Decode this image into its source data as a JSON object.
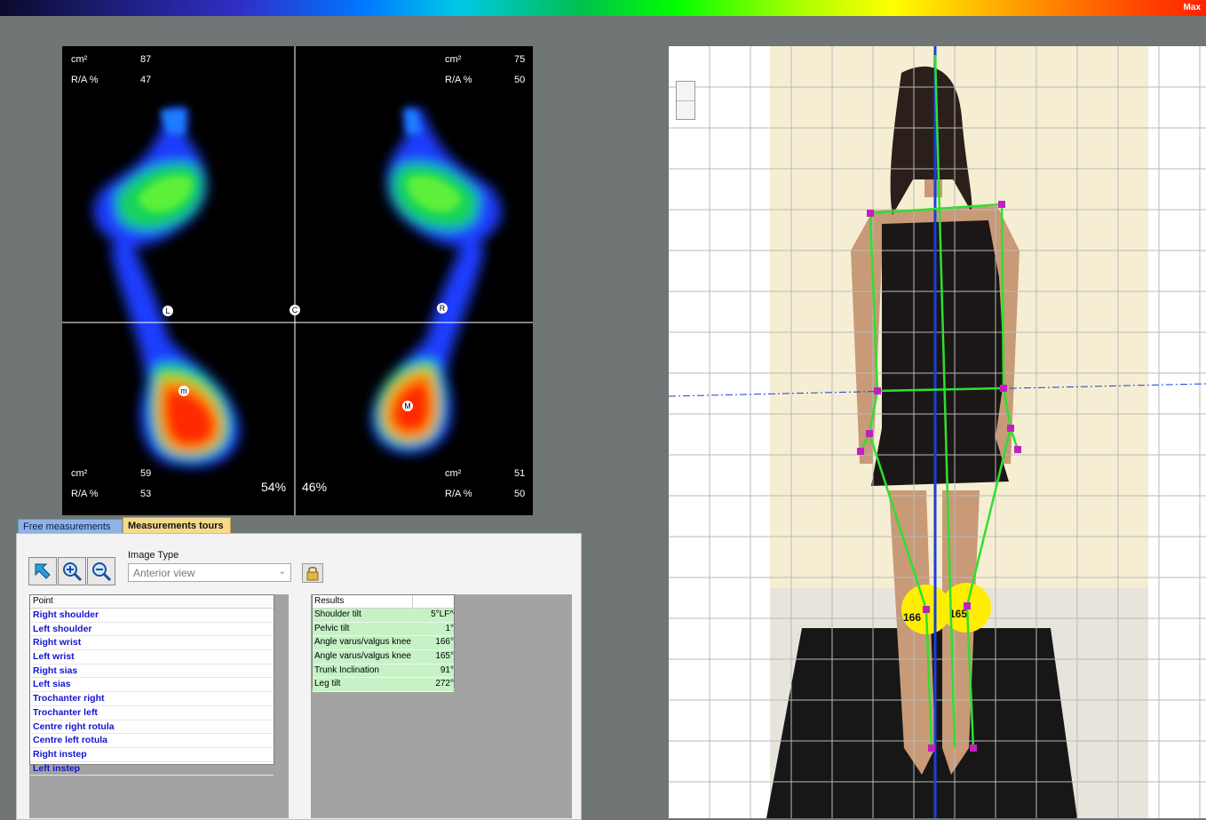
{
  "colorbar": {
    "max_label": "Max"
  },
  "footmap": {
    "top_left": {
      "area_label": "cm²",
      "area_value": "87",
      "ra_label": "R/A %",
      "ra_value": "47"
    },
    "top_right": {
      "area_label": "cm²",
      "area_value": "75",
      "ra_label": "R/A %",
      "ra_value": "50"
    },
    "bottom_left": {
      "area_label": "cm²",
      "area_value": "59",
      "ra_label": "R/A %",
      "ra_value": "53"
    },
    "bottom_right": {
      "area_label": "cm²",
      "area_value": "51",
      "ra_label": "R/A %",
      "ra_value": "50"
    },
    "left_percent": "54%",
    "right_percent": "46%",
    "markers": {
      "left": "L",
      "center": "C",
      "right": "R",
      "left_heel": "m",
      "right_heel": "M"
    }
  },
  "tabs": {
    "free": "Free measurements",
    "tours": "Measurements tours"
  },
  "image_type": {
    "label": "Image Type",
    "value": "Anterior view"
  },
  "points": {
    "header": "Point",
    "items": [
      "Right shoulder",
      "Left shoulder",
      "Right wrist",
      "Left wrist",
      "Right sias",
      "Left sias",
      "Trochanter right",
      "Trochanter left",
      "Centre right rotula",
      "Centre left rotula",
      "Right instep",
      "Left instep"
    ]
  },
  "results": {
    "header": "Results",
    "rows": [
      {
        "name": "Shoulder tilt",
        "value": "5°LF^"
      },
      {
        "name": "Pelvic tilt",
        "value": "1°"
      },
      {
        "name": "Angle varus/valgus knee",
        "value": "166°"
      },
      {
        "name": "Angle varus/valgus knee",
        "value": "165°"
      },
      {
        "name": "Trunk Inclination",
        "value": "91°"
      },
      {
        "name": "Leg tilt",
        "value": "272°"
      }
    ]
  },
  "photo": {
    "knee_right_label": "166",
    "knee_left_label": "165"
  },
  "colors": {
    "grid": "#b9b9b9",
    "skeleton": "#2ee02e",
    "landmark": "#c21fbf",
    "axis": "#1b3fd6",
    "knee_marker": "#ffee00"
  }
}
